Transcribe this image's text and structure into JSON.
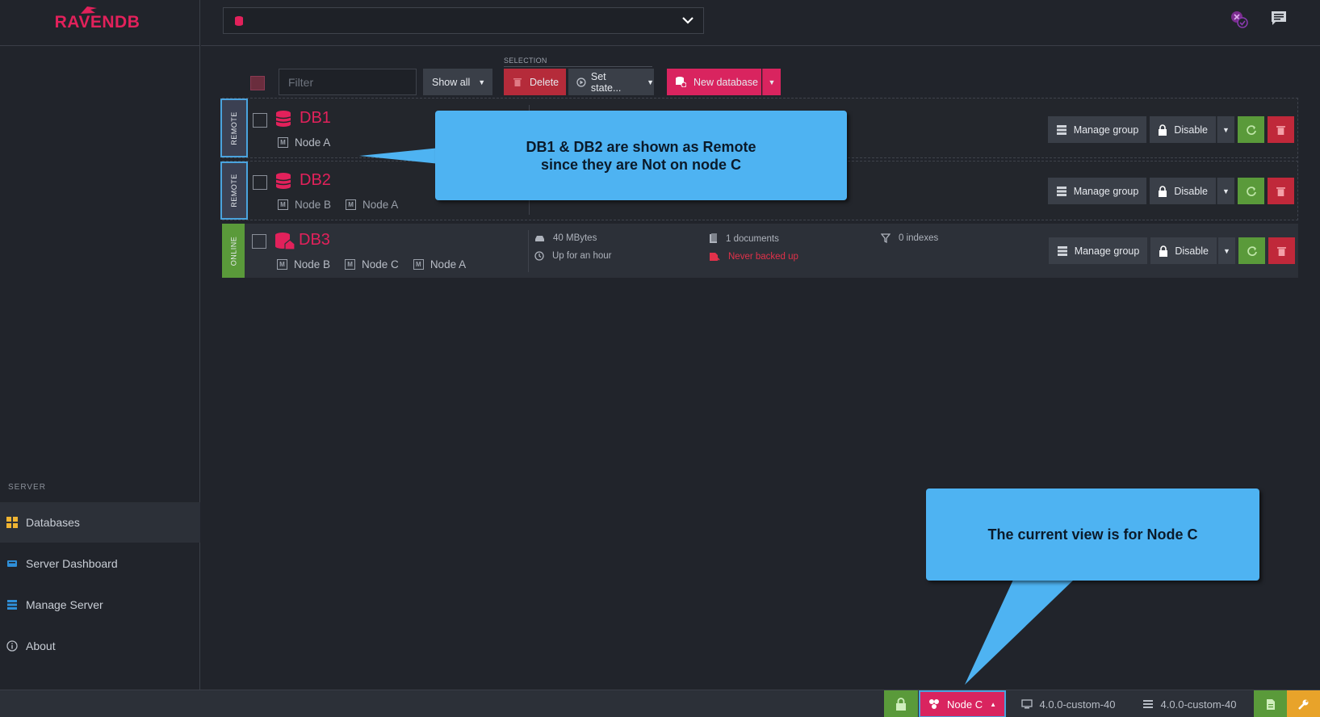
{
  "brand": {
    "logo": "RAVENDB"
  },
  "topbar": {
    "db_select_value": "",
    "icons": [
      "cluster-status-icon",
      "notifications-icon"
    ]
  },
  "sidebar": {
    "section_label": "SERVER",
    "items": [
      {
        "label": "Databases",
        "icon": "databases-icon",
        "active": true
      },
      {
        "label": "Server Dashboard",
        "icon": "dashboard-icon"
      },
      {
        "label": "Manage Server",
        "icon": "manage-server-icon"
      },
      {
        "label": "About",
        "icon": "info-icon"
      }
    ]
  },
  "toolbar": {
    "filter_placeholder": "Filter",
    "show_all_label": "Show all",
    "selection_label": "SELECTION",
    "delete_label": "Delete",
    "set_state_label": "Set state...",
    "new_database_label": "New database"
  },
  "databases": [
    {
      "name": "DB1",
      "state": "REMOTE",
      "nodes": [
        "Node A"
      ]
    },
    {
      "name": "DB2",
      "state": "REMOTE",
      "nodes": [
        "Node B",
        "Node A"
      ]
    },
    {
      "name": "DB3",
      "state": "ONLINE",
      "nodes": [
        "Node B",
        "Node C",
        "Node A"
      ],
      "size": "40 MBytes",
      "uptime": "Up for an hour",
      "documents": "1 documents",
      "backup": "Never backed up",
      "indexes": "0 indexes"
    }
  ],
  "row_actions": {
    "manage_group": "Manage group",
    "disable": "Disable"
  },
  "callouts": {
    "remote_line1": "DB1 & DB2 are shown as Remote",
    "remote_line2": "since they are Not on node C",
    "node_view": "The current view is for Node C"
  },
  "statusbar": {
    "node_label": "Node C",
    "server_version": "4.0.0-custom-40",
    "client_version": "4.0.0-custom-40"
  },
  "colors": {
    "accent": "#e2215b",
    "online": "#5a9a3a",
    "danger": "#c0283a",
    "callout": "#4eb3f2"
  }
}
